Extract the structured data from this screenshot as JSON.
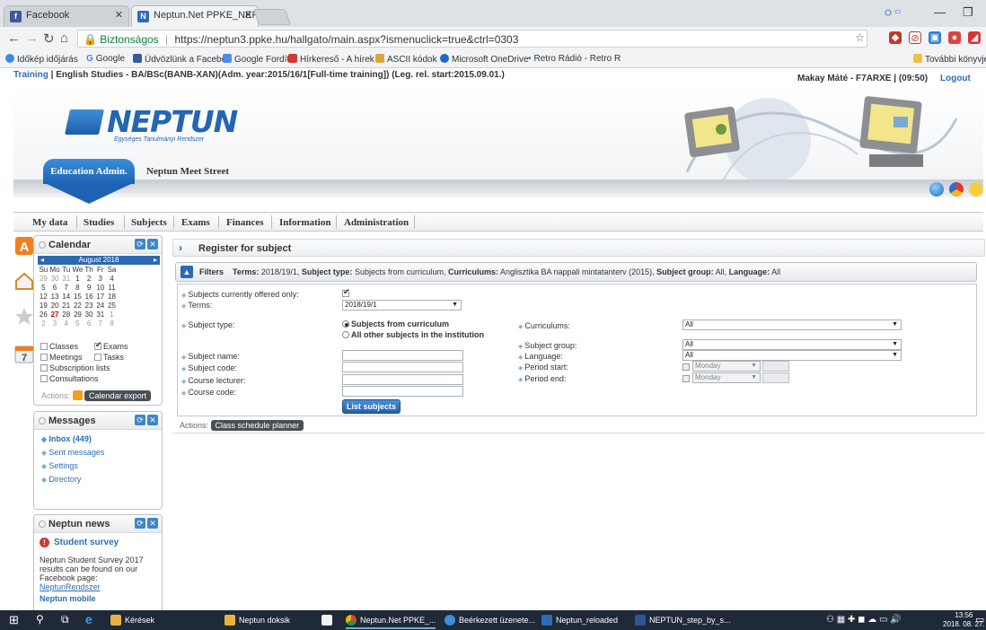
{
  "browser": {
    "tabs": [
      {
        "title": "Facebook",
        "favicon": "f",
        "favicon_color": "#3b5998"
      },
      {
        "title": "Neptun.Net PPKE_NEPTU",
        "favicon": "N",
        "favicon_color": "#2d6db5"
      }
    ],
    "address": {
      "secure_label": "Biztonságos",
      "url": "https://neptun3.ppke.hu/hallgato/main.aspx?ismenuclick=true&ctrl=0303"
    },
    "bookmarks": [
      "Időkép időjárás",
      "Google",
      "Üdvözlünk a Faceboo",
      "Google Fordító",
      "Hírkereső - A hírek ir",
      "ASCII kódok",
      "Microsoft OneDrive",
      "Retro Rádió - Retro R"
    ],
    "other_bookmarks": "További könyvjelzők"
  },
  "infobar": {
    "training_label": "Training",
    "training_text": " | English Studies - BA/BSc(BANB-XAN)(Adm. year:2015/16/1[Full-time training]) (Leg. rel. start:2015.09.01.)",
    "user": "Makay Máté - F7ARXE",
    "time": "(09:50)",
    "logout": "Logout"
  },
  "header": {
    "logo_text": "NEPTUN",
    "logo_sub": "Egységes Tanulmányi Rendszer",
    "edu_tab": "Education Admin.",
    "meet_street": "Neptun Meet Street"
  },
  "menu": [
    "My data",
    "Studies",
    "Subjects",
    "Exams",
    "Finances",
    "Information",
    "Administration"
  ],
  "calendar": {
    "title": "Calendar",
    "month": "August 2018",
    "weekdays": [
      "Su",
      "Mo",
      "Tu",
      "We",
      "Th",
      "Fr",
      "Sa"
    ],
    "weeks": [
      [
        "29",
        "30",
        "31",
        "1",
        "2",
        "3",
        "4"
      ],
      [
        "5",
        "6",
        "7",
        "8",
        "9",
        "10",
        "11"
      ],
      [
        "12",
        "13",
        "14",
        "15",
        "16",
        "17",
        "18"
      ],
      [
        "19",
        "20",
        "21",
        "22",
        "23",
        "24",
        "25"
      ],
      [
        "26",
        "27",
        "28",
        "29",
        "30",
        "31",
        "1"
      ],
      [
        "2",
        "3",
        "4",
        "5",
        "6",
        "7",
        "8"
      ]
    ],
    "today": "27",
    "options": {
      "classes": "Classes",
      "exams": "Exams",
      "meetings": "Meetings",
      "tasks": "Tasks",
      "subscription": "Subscription lists",
      "consultations": "Consultations"
    },
    "actions_label": "Actions:",
    "export": "Calendar export"
  },
  "messages": {
    "title": "Messages",
    "inbox": "Inbox (449)",
    "sent": "Sent messages",
    "settings": "Settings",
    "directory": "Directory"
  },
  "news": {
    "title": "Neptun news",
    "survey_title": "Student survey",
    "survey_text": "Neptun Student Survey 2017 results can be found on our Facebook page: ",
    "survey_link": "NeptunRendszer",
    "mobile": "Neptun mobile"
  },
  "content": {
    "title": "Register for subject",
    "filters_label": "Filters",
    "filters_summary": {
      "terms_k": "Terms:",
      "terms_v": " 2018/19/1, ",
      "stype_k": "Subject type:",
      "stype_v": " Subjects from curriculum, ",
      "curr_k": "Curriculums:",
      "curr_v": " Anglisztika BA nappali mintatanterv (2015), ",
      "group_k": "Subject group:",
      "group_v": " All, ",
      "lang_k": "Language:",
      "lang_v": " All"
    },
    "form": {
      "offered_only": "Subjects currently offered only:",
      "terms": "Terms:",
      "terms_value": "2018/19/1",
      "subject_type": "Subject type:",
      "type_curriculum": "Subjects from curriculum",
      "type_other": "All other subjects in the institution",
      "curriculums": "Curriculums:",
      "curriculums_value": "All",
      "subject_group": "Subject group:",
      "subject_group_value": "All",
      "language": "Language:",
      "language_value": "All",
      "subject_name": "Subject name:",
      "subject_code": "Subject code:",
      "course_lecturer": "Course lecturer:",
      "course_code": "Course code:",
      "period_start": "Period start:",
      "period_end": "Period end:",
      "period_day": "Monday",
      "list_button": "List subjects"
    },
    "actions_label": "Actions:",
    "planner": "Class schedule planner"
  },
  "taskbar": {
    "items": [
      "Kérések",
      "Neptun doksik",
      "Neptun.Net PPKE_...",
      "Beérkezett üzenete...",
      "Neptun_reloaded",
      "NEPTUN_step_by_s..."
    ],
    "time": "13:56",
    "date": "2018. 08. 27."
  }
}
